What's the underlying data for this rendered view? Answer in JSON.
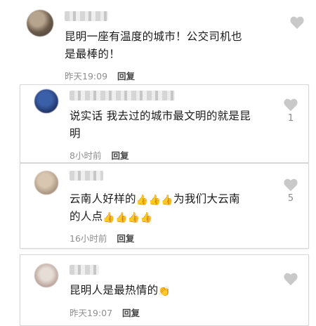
{
  "comments": [
    {
      "text_line1": "昆明一座有温度的城市！公交司机也",
      "text_line2": "是最棒的！",
      "time": "昨天19:09",
      "reply": "回复",
      "likes": ""
    },
    {
      "text_line1": "说实话 我去过的城市最文明的就是昆",
      "text_line2": "明",
      "time": "8小时前",
      "reply": "回复",
      "likes": "1"
    },
    {
      "text_line1a": "云南人好样的",
      "text_line1b": "为我们大云南",
      "text_line2a": "的人点",
      "time": "16小时前",
      "reply": "回复",
      "likes": "5",
      "thumb_emoji": "👍"
    },
    {
      "text_line1": "昆明人是最热情的",
      "time": "昨天19:07",
      "reply": "回复",
      "likes": "",
      "clap_emoji": "👏"
    }
  ],
  "icons": {
    "like": "heart-icon",
    "heart_color": "#c9c9c9"
  }
}
